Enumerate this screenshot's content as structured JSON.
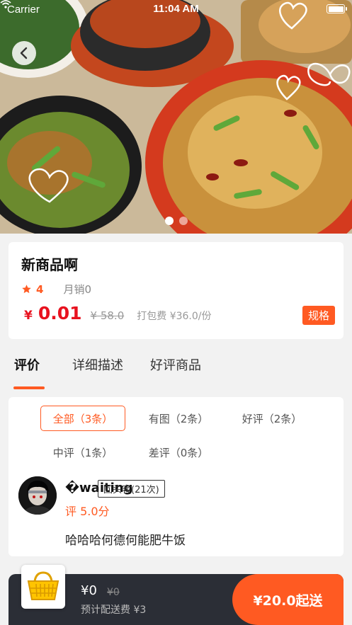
{
  "status_bar": {
    "carrier": "Carrier",
    "time": "11:04 AM"
  },
  "hero": {
    "image": "food-dishes-photo",
    "slide_count": 2,
    "active_slide": 1
  },
  "product": {
    "name": "新商品啊",
    "rating": "4",
    "monthly_sales": "月销0",
    "price_symbol": "¥",
    "price": "0.01",
    "original_price": "¥ 58.0",
    "packing_fee": "打包费 ¥36.0/份",
    "spec_label": "规格"
  },
  "tabs": [
    {
      "label": "评价",
      "active": true
    },
    {
      "label": "详细描述",
      "active": false
    },
    {
      "label": "好评商品",
      "active": false
    }
  ],
  "review_filters": [
    {
      "label": "全部（3条）",
      "selected": true
    },
    {
      "label": "有图（2条）",
      "selected": false
    },
    {
      "label": "好评（2条）",
      "selected": false
    },
    {
      "label": "中评（1条）",
      "selected": false
    },
    {
      "label": "差评（0条）",
      "selected": false
    }
  ],
  "review": {
    "user_name": "�waiting",
    "badge": "回头客(21次)",
    "score": "评 5.0分",
    "text": "哈哈哈何德何能肥牛饭"
  },
  "cart": {
    "total": "¥0",
    "original": "¥0",
    "delivery_fee": "预计配送费 ¥3",
    "checkout_label": "¥20.0起送"
  },
  "colors": {
    "accent": "#ff5a22",
    "price": "#e8121f",
    "bar": "#2b2e36"
  }
}
